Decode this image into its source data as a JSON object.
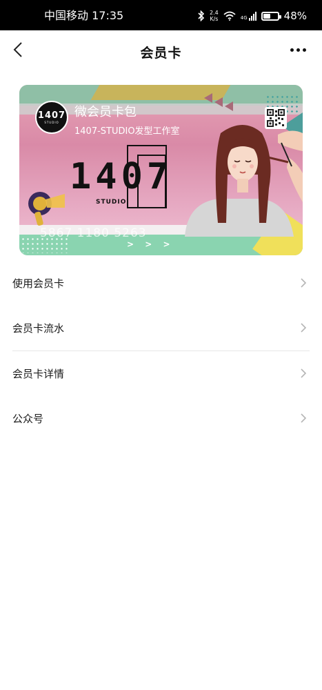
{
  "status_bar": {
    "carrier_time": "中国移动 17:35",
    "net_speed_value": "2.4",
    "net_speed_unit": "K/s",
    "network_type": "4G",
    "battery_text": "48%",
    "battery_level": 0.48
  },
  "header": {
    "title": "会员卡"
  },
  "card": {
    "logo_number": "1407",
    "logo_sub": "STUDIO",
    "name": "微会员卡包",
    "merchant": "1407-STUDIO发型工作室",
    "brand_number": "1407",
    "brand_sub": "STUDIO",
    "card_number": "5867 1180 5263",
    "arrows": "> > >",
    "colors": {
      "pink": "#e2a0b8",
      "green": "#8ad4b0",
      "yellow": "#f0e05a",
      "teal": "#4d9e9b"
    }
  },
  "menu": {
    "items": [
      {
        "label": "使用会员卡",
        "icon": "chevron-right-icon"
      },
      {
        "label": "会员卡流水",
        "icon": "chevron-right-icon"
      },
      {
        "label": "会员卡详情",
        "icon": "chevron-right-icon"
      },
      {
        "label": "公众号",
        "icon": "chevron-right-icon"
      }
    ]
  }
}
